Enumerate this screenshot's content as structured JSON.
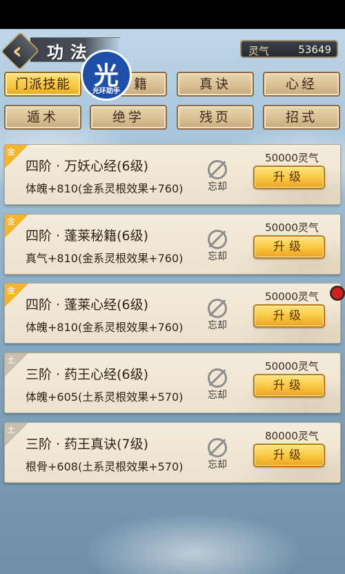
{
  "header": {
    "title": "功法",
    "currency_label": "灵气",
    "currency_value": "53649"
  },
  "watermark": {
    "char": "光",
    "sub": "光环助手"
  },
  "tabs": [
    {
      "label": "门派技能",
      "active": true
    },
    {
      "label": "籍",
      "active": false
    },
    {
      "label": "真诀",
      "active": false
    },
    {
      "label": "心经",
      "active": false
    },
    {
      "label": "遁术",
      "active": false
    },
    {
      "label": "绝学",
      "active": false
    },
    {
      "label": "残页",
      "active": false
    },
    {
      "label": "招式",
      "active": false
    }
  ],
  "skills": [
    {
      "element": "金",
      "name": "四阶 · 万妖心经(6级)",
      "effect": "体魄+810(金系灵根效果+760)",
      "forget_label": "忘却",
      "cost": "50000灵气",
      "upgrade_label": "升级"
    },
    {
      "element": "金",
      "name": "四阶 · 蓬莱秘籍(6级)",
      "effect": "真气+810(金系灵根效果+760)",
      "forget_label": "忘却",
      "cost": "50000灵气",
      "upgrade_label": "升级"
    },
    {
      "element": "金",
      "name": "四阶 · 蓬莱心经(6级)",
      "effect": "体魄+810(金系灵根效果+760)",
      "forget_label": "忘却",
      "cost": "50000灵气",
      "upgrade_label": "升级"
    },
    {
      "element": "土",
      "name": "三阶 · 药王心经(6级)",
      "effect": "体魄+605(土系灵根效果+570)",
      "forget_label": "忘却",
      "cost": "50000灵气",
      "upgrade_label": "升级"
    },
    {
      "element": "土",
      "name": "三阶 · 药王真诀(7级)",
      "effect": "根骨+608(土系灵根效果+570)",
      "forget_label": "忘却",
      "cost": "80000灵气",
      "upgrade_label": "升级"
    }
  ],
  "colors": {
    "gold_corner": "#f4b52c",
    "earth_corner": "#c9bfae",
    "button_gold": "#f9c640"
  }
}
